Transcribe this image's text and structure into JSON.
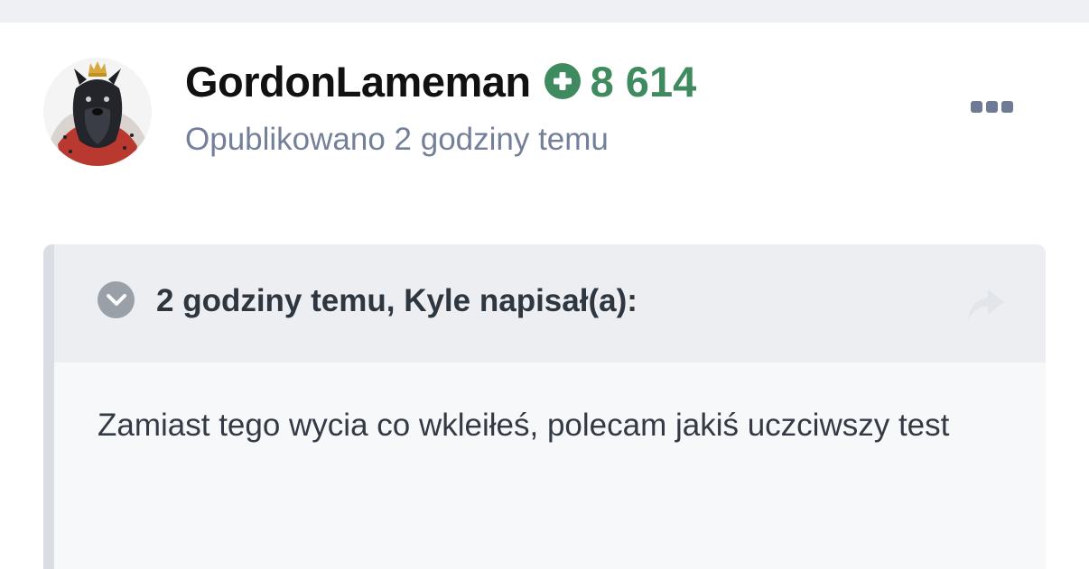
{
  "post": {
    "author": "GordonLameman",
    "reputation": "8 614",
    "posted_meta": "Opublikowano 2 godziny temu"
  },
  "quote": {
    "citation": "2 godziny temu, Kyle napisał(a):",
    "body": "Zamiast tego wycia co wkleiłeś, polecam jakiś uczciwszy test"
  },
  "icons": {
    "reputation": "plus-circle-icon",
    "more": "ellipsis-icon",
    "toggle": "chevron-down-circle-icon",
    "share": "share-arrow-icon"
  },
  "colors": {
    "reputation_green": "#3f8a5e",
    "meta_gray": "#74809a",
    "quote_header_bg": "#eceef2",
    "quote_body_bg": "#f7f8fa",
    "quote_border": "#dadde3"
  }
}
